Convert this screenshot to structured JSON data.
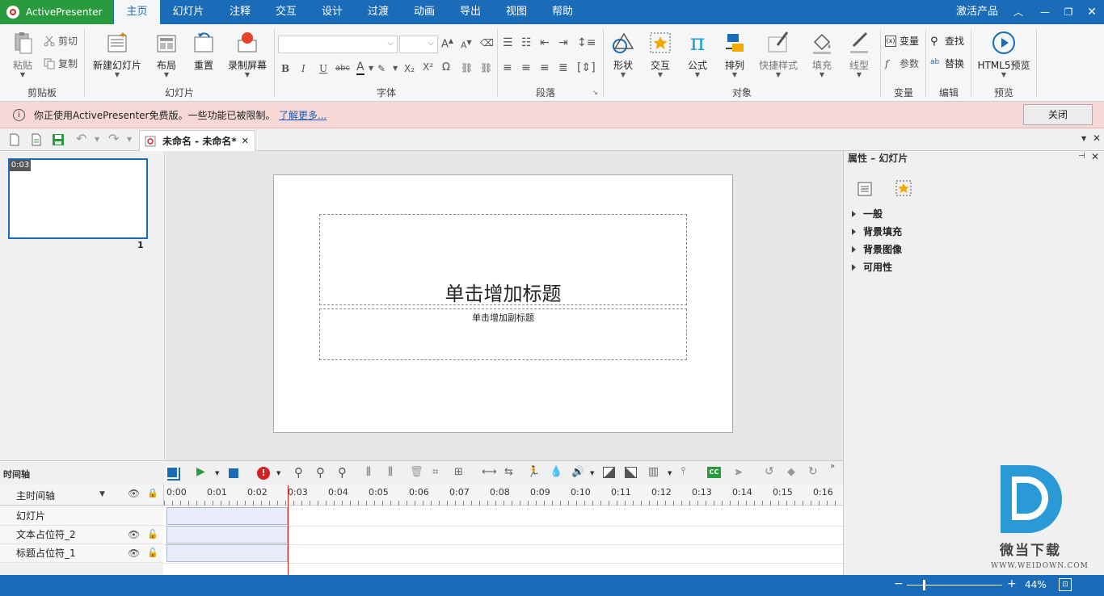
{
  "app": {
    "name": "ActivePresenter"
  },
  "menu": {
    "tabs": [
      "主页",
      "幻灯片",
      "注释",
      "交互",
      "设计",
      "过渡",
      "动画",
      "导出",
      "视图",
      "帮助"
    ],
    "activate": "激活产品"
  },
  "ribbon": {
    "clipboard": {
      "paste": "粘贴",
      "cut": "剪切",
      "copy": "复制",
      "group": "剪贴板"
    },
    "slides": {
      "new_slide": "新建幻灯片",
      "layout": "布局",
      "reset": "重置",
      "record": "录制屏幕",
      "group": "幻灯片"
    },
    "font": {
      "group": "字体",
      "bold": "B",
      "italic": "I",
      "underline": "U",
      "strike": "abc",
      "font_color": "A",
      "sub": "X₂",
      "sup": "X²",
      "omega": "Ω"
    },
    "paragraph": {
      "group": "段落"
    },
    "objects": {
      "shape": "形状",
      "interaction": "交互",
      "equation": "公式",
      "arrange": "排列",
      "quick_style": "快捷样式",
      "fill": "填充",
      "line": "线型",
      "group": "对象"
    },
    "variables": {
      "variable": "变量",
      "parameter": "参数",
      "group": "变量"
    },
    "edit": {
      "find": "查找",
      "replace": "替换",
      "group": "编辑"
    },
    "preview": {
      "html5": "HTML5预览",
      "group": "预览"
    }
  },
  "notice": {
    "message": "你正使用ActivePresenter免费版。一些功能已被限制。",
    "link": "了解更多...",
    "close": "关闭"
  },
  "document": {
    "tab_title": "未命名 - 未命名*"
  },
  "slides_panel": {
    "duration": "0:03",
    "number": "1"
  },
  "slide": {
    "title_placeholder": "单击增加标题",
    "subtitle_placeholder": "单击增加副标题"
  },
  "properties": {
    "header": "属性 – 幻灯片",
    "sections": [
      "一般",
      "背景填充",
      "背景图像",
      "可用性"
    ]
  },
  "timeline": {
    "title": "时间轴",
    "main_track": "主时间轴",
    "ticks": [
      "0:00",
      "0:01",
      "0:02",
      "0:03",
      "0:04",
      "0:05",
      "0:06",
      "0:07",
      "0:08",
      "0:09",
      "0:10",
      "0:11",
      "0:12",
      "0:13",
      "0:14",
      "0:15",
      "0:16"
    ],
    "tracks": [
      "幻灯片",
      "文本占位符_2",
      "标题占位符_1"
    ],
    "cc": "CC"
  },
  "status": {
    "zoom": "44%"
  },
  "watermark": {
    "name": "微当下载",
    "url": "WWW.WEIDOWN.COM"
  },
  "colors": {
    "accent": "#1a6bb8",
    "app_green": "#2a9a3e",
    "notice_bg": "#f8d7d7",
    "playhead": "#d62020"
  }
}
